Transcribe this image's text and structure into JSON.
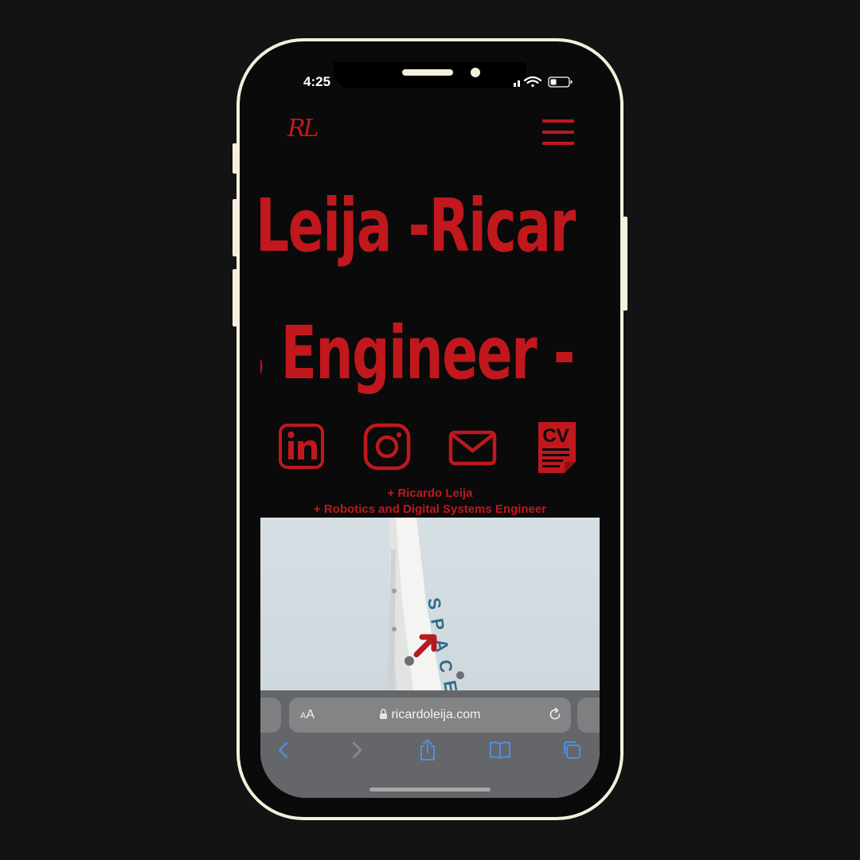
{
  "status": {
    "time": "4:25"
  },
  "site": {
    "logo": "RL",
    "marquee_line1": "Leija -Ricar",
    "marquee_line2": "s Engineer -",
    "social": {
      "cv_label": "CV"
    },
    "tagline_name": "+ Ricardo Leija",
    "tagline_title": "+ Robotics and Digital Systems Engineer"
  },
  "browser": {
    "aa_small": "A",
    "aa_large": "A",
    "url": "ricardoleija.com"
  },
  "colors": {
    "accent_red": "#c0181d",
    "page_bg": "#0a0a0a",
    "phone_frame": "#f5f0dc",
    "ios_blue": "#4f8fe0"
  }
}
